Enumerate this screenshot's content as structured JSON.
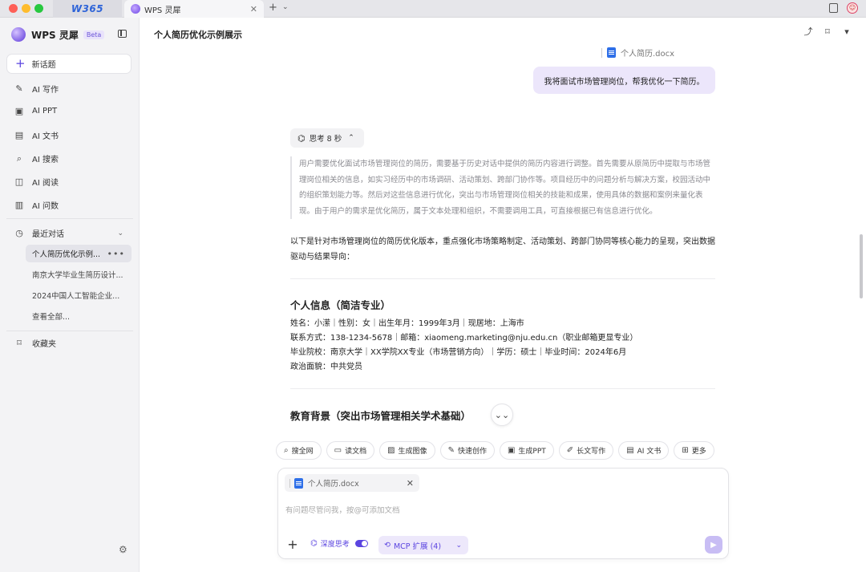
{
  "titlebar": {
    "tab_w365": "W365",
    "active_tab": "WPS 灵犀",
    "tab_close": "✕",
    "new_tab": "+",
    "tab_menu": "⌄"
  },
  "sidebar": {
    "brand": "WPS 灵犀",
    "beta": "Beta",
    "new_chat": "新话题",
    "nav": [
      {
        "label": "AI 写作",
        "icon": "pen-icon"
      },
      {
        "label": "AI PPT",
        "icon": "ppt-icon"
      },
      {
        "label": "AI 文书",
        "icon": "doc-icon"
      },
      {
        "label": "AI 搜索",
        "icon": "search-icon"
      },
      {
        "label": "AI 阅读",
        "icon": "book-icon"
      },
      {
        "label": "AI 问数",
        "icon": "chart-icon"
      }
    ],
    "recent_label": "最近对话",
    "recent": [
      "个人简历优化示例...",
      "南京大学毕业生简历设计...",
      "2024中国人工智能企业...",
      "查看全部..."
    ],
    "favorites": "收藏夹"
  },
  "main": {
    "title": "个人简历优化示例展示",
    "file_name": "个人简历.docx",
    "user_message": "我将面试市场管理岗位，帮我优化一下简历。",
    "thinking_label": "思考 8 秒",
    "thinking_text": "用户需要优化面试市场管理岗位的简历，需要基于历史对话中提供的简历内容进行调整。首先需要从原简历中提取与市场管理岗位相关的信息，如实习经历中的市场调研、活动策划、跨部门协作等。项目经历中的问题分析与解决方案，校园活动中的组织策划能力等。然后对这些信息进行优化，突出与市场管理岗位相关的技能和成果，使用具体的数据和案例来量化表现。由于用户的需求是优化简历，属于文本处理和组织，不需要调用工具，可直接根据已有信息进行优化。",
    "answer_intro": "以下是针对市场管理岗位的简历优化版本，重点强化市场策略制定、活动策划、跨部门协同等核心能力的呈现，突出数据驱动与结果导向：",
    "section1_title": "个人信息（简洁专业）",
    "info_lines": [
      "姓名：小潆｜性别：女｜出生年月：1999年3月｜现居地：上海市",
      "联系方式：138-1234-5678｜邮箱：xiaomeng.marketing@nju.edu.cn（职业邮箱更显专业）",
      "毕业院校：南京大学｜XX学院XX专业（市场营销方向）｜学历：硕士｜毕业时间：2024年6月",
      "政治面貌：中共党员"
    ],
    "section2_title": "教育背景（突出市场管理相关学术基础）"
  },
  "chips": [
    {
      "label": "搜全网",
      "icon": "globe-search-icon"
    },
    {
      "label": "读文档",
      "icon": "read-doc-icon"
    },
    {
      "label": "生成图像",
      "icon": "image-icon"
    },
    {
      "label": "快速创作",
      "icon": "quick-create-icon"
    },
    {
      "label": "生成PPT",
      "icon": "ppt-icon"
    },
    {
      "label": "长文写作",
      "icon": "long-write-icon"
    },
    {
      "label": "AI 文书",
      "icon": "doc-icon"
    },
    {
      "label": "更多",
      "icon": "more-icon"
    }
  ],
  "composer": {
    "attachment": "个人简历.docx",
    "placeholder": "有问题尽管问我，按@可添加文档",
    "deep_think": "深度思考",
    "mcp": "MCP 扩展 (4)"
  },
  "colors": {
    "accent": "#5b45e0",
    "user_bubble": "#ece6fb",
    "sidebar_bg": "#f3f3f5"
  }
}
